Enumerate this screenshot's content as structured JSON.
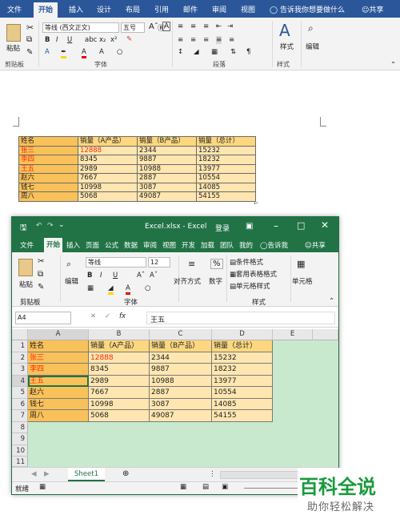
{
  "word": {
    "tabs": [
      "文件",
      "开始",
      "插入",
      "设计",
      "布局",
      "引用",
      "邮件",
      "审阅",
      "视图"
    ],
    "tell_me": "告诉我你想要做什么",
    "share": "共享",
    "clipboard": {
      "paste": "粘贴",
      "group": "剪贴板"
    },
    "font": {
      "name": "等线 (西文正文)",
      "size": "五号",
      "group": "字体"
    },
    "paragraph": {
      "group": "段落"
    },
    "styles": {
      "label": "样式",
      "group": "样式"
    },
    "editing": {
      "label": "编辑"
    },
    "table": {
      "rows": [
        [
          "姓名",
          "销量（A产品）",
          "销量（B产品）",
          "销量（总计）"
        ],
        [
          "张三",
          "12888",
          "2344",
          "15232"
        ],
        [
          "李四",
          "8345",
          "9887",
          "18232"
        ],
        [
          "王五",
          "2989",
          "10988",
          "13977"
        ],
        [
          "赵六",
          "7667",
          "2887",
          "10554"
        ],
        [
          "钱七",
          "10998",
          "3087",
          "14085"
        ],
        [
          "周八",
          "5068",
          "49087",
          "54155"
        ]
      ]
    }
  },
  "excel": {
    "title": "Excel.xlsx - Excel",
    "login": "登录",
    "tabs": [
      "文件",
      "开始",
      "插入",
      "页面",
      "公式",
      "数据",
      "审阅",
      "视图",
      "开发",
      "加载",
      "团队",
      "我的"
    ],
    "tell_me": "告诉我",
    "share": "共享",
    "clipboard": {
      "paste": "粘贴",
      "group": "剪贴板"
    },
    "font": {
      "name": "等线",
      "size": "12",
      "group": "字体"
    },
    "editing": "编辑",
    "alignment": "对齐方式",
    "number": "数字",
    "styles": {
      "conditional": "条件格式",
      "table_format": "套用表格格式",
      "cell_styles": "单元格样式",
      "group": "样式"
    },
    "cells": "单元格",
    "name_box": "A4",
    "formula_value": "王五",
    "fx": "fx",
    "columns": [
      "A",
      "B",
      "C",
      "D",
      "E"
    ],
    "row_numbers": [
      "1",
      "2",
      "3",
      "4",
      "5",
      "6",
      "7",
      "8",
      "9",
      "10",
      "11"
    ],
    "table": {
      "rows": [
        [
          "姓名",
          "销量（A产品）",
          "销量（B产品）",
          "销量（总计）"
        ],
        [
          "张三",
          "12888",
          "2344",
          "15232"
        ],
        [
          "李四",
          "8345",
          "9887",
          "18232"
        ],
        [
          "王五",
          "2989",
          "10988",
          "13977"
        ],
        [
          "赵六",
          "7667",
          "2887",
          "10554"
        ],
        [
          "钱七",
          "10998",
          "3087",
          "14085"
        ],
        [
          "周八",
          "5068",
          "49087",
          "54155"
        ]
      ]
    },
    "sheet_tab": "Sheet1",
    "status": "就绪"
  },
  "watermark": {
    "brand": "百科全说",
    "slogan": "助你轻松解决"
  },
  "colors": {
    "word_blue": "#2b579a",
    "excel_green": "#217346",
    "header_cell": "#fcd77f",
    "data_cell": "#ffe6b0",
    "name_cell": "#f9c15a",
    "red_text": "#ff2a00"
  }
}
